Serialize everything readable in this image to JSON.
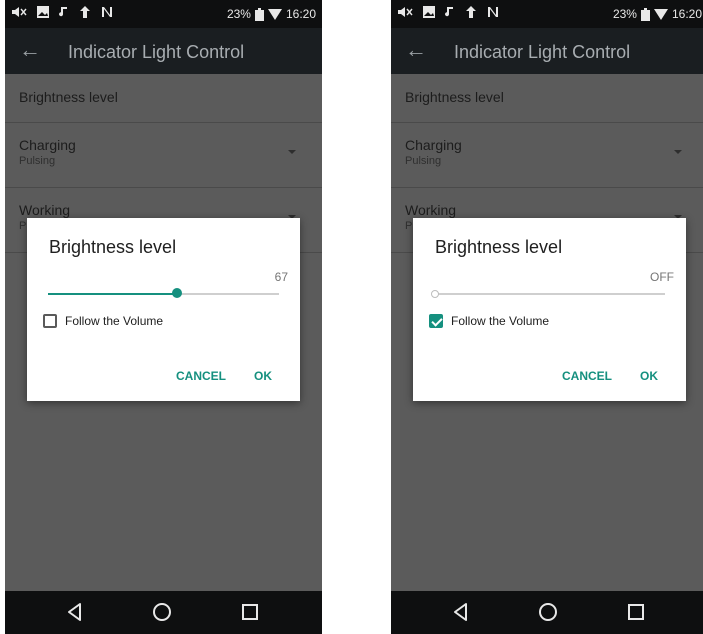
{
  "screens": [
    {
      "status": {
        "icons": [
          "mute-icon",
          "image-icon",
          "music-icon",
          "upload-icon",
          "nfc-icon"
        ],
        "battery": "23%",
        "time": "16:20"
      },
      "appbar": {
        "title": "Indicator Light Control"
      },
      "list": [
        {
          "title": "Brightness level"
        },
        {
          "title": "Charging",
          "summary": "Pulsing"
        },
        {
          "title": "Working",
          "summary": "P"
        }
      ],
      "dialog": {
        "title": "Brightness level",
        "value_label": "67",
        "slider_fraction": 0.56,
        "follow_volume_label": "Follow the Volume",
        "follow_volume_checked": false,
        "cancel": "CANCEL",
        "ok": "OK"
      }
    },
    {
      "status": {
        "icons": [
          "mute-icon",
          "image-icon",
          "music-icon",
          "upload-icon",
          "nfc-icon"
        ],
        "battery": "23%",
        "time": "16:20"
      },
      "appbar": {
        "title": "Indicator Light Control"
      },
      "list": [
        {
          "title": "Brightness level"
        },
        {
          "title": "Charging",
          "summary": "Pulsing"
        },
        {
          "title": "Working",
          "summary": "P"
        }
      ],
      "dialog": {
        "title": "Brightness level",
        "value_label": "OFF",
        "slider_fraction": 0,
        "follow_volume_label": "Follow the Volume",
        "follow_volume_checked": true,
        "cancel": "CANCEL",
        "ok": "OK"
      }
    }
  ],
  "colors": {
    "accent": "#15907f",
    "scrim": "#5b5b5b",
    "appbar": "#1a1e21",
    "statusbar": "#0e0f10"
  }
}
